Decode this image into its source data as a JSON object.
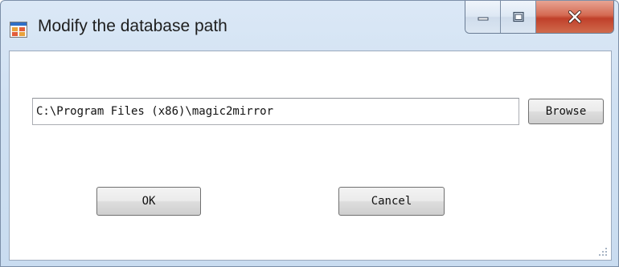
{
  "window": {
    "title": "Modify the database path",
    "app_icon": "form-window-icon",
    "caption_buttons": {
      "minimize_icon": "minimize-icon",
      "maximize_icon": "maximize-icon",
      "close_icon": "close-icon"
    },
    "colors": {
      "frame": "#cfe0f2",
      "close_button": "#c9442c",
      "client_background": "#ffffff"
    }
  },
  "form": {
    "path_value": "C:\\Program Files (x86)\\magic2mirror",
    "browse_label": "Browse",
    "ok_label": "OK",
    "cancel_label": "Cancel"
  }
}
